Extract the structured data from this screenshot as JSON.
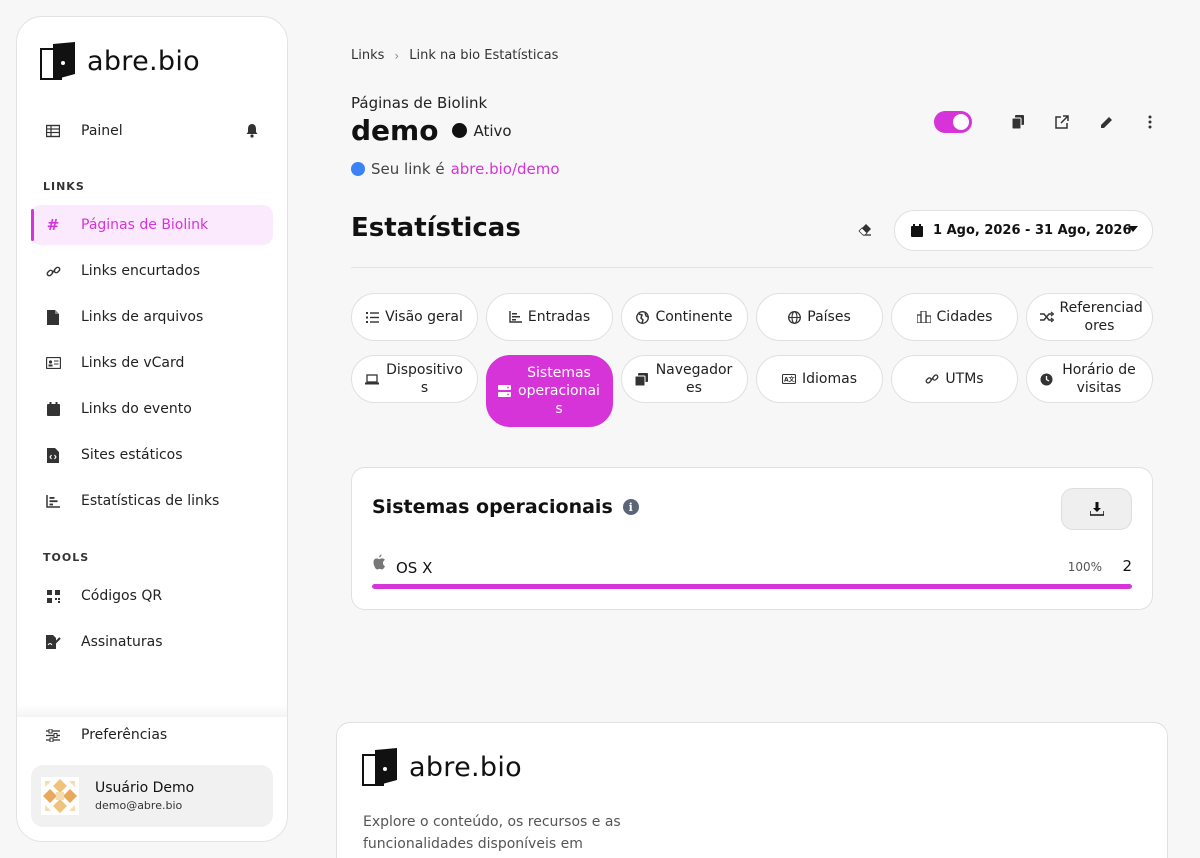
{
  "brand": {
    "name": "abre.bio",
    "accent": "#d633d9"
  },
  "sidebar": {
    "painel": "Painel",
    "section_links": "LINKS",
    "items": [
      {
        "label": "Páginas de Biolink",
        "icon": "hash-icon"
      },
      {
        "label": "Links encurtados",
        "icon": "link-icon"
      },
      {
        "label": "Links de arquivos",
        "icon": "file-icon"
      },
      {
        "label": "Links de vCard",
        "icon": "vcard-icon"
      },
      {
        "label": "Links do evento",
        "icon": "calendar-icon"
      },
      {
        "label": "Sites estáticos",
        "icon": "file-code-icon"
      },
      {
        "label": "Estatísticas de links",
        "icon": "chart-icon"
      }
    ],
    "section_tools": "TOOLS",
    "tools": [
      {
        "label": "Códigos QR",
        "icon": "qr-icon"
      },
      {
        "label": "Assinaturas",
        "icon": "signature-icon"
      }
    ],
    "preferences": "Preferências",
    "user": {
      "name": "Usuário Demo",
      "email": "demo@abre.bio"
    }
  },
  "breadcrumb": {
    "first": "Links",
    "sep": "›",
    "current": "Link na bio Estatísticas"
  },
  "header": {
    "kicker": "Páginas de Biolink",
    "title": "demo",
    "status": "Ativo",
    "link_prefix": "Seu link é",
    "link_url": "abre.bio/demo"
  },
  "stats": {
    "title": "Estatísticas",
    "date_range": "1 Ago, 2026 - 31 Ago, 2026"
  },
  "tabs": [
    {
      "label": "Visão geral",
      "icon": "list-icon"
    },
    {
      "label": "Entradas",
      "icon": "bar-chart-icon"
    },
    {
      "label": "Continente",
      "icon": "globe-americas-icon"
    },
    {
      "label": "Países",
      "icon": "globe-icon"
    },
    {
      "label": "Cidades",
      "icon": "city-icon"
    },
    {
      "label": "Referenciad ores",
      "icon": "random-icon"
    },
    {
      "label": "Dispositivo s",
      "icon": "laptop-icon"
    },
    {
      "label": "Sistemas operacionai s",
      "icon": "server-icon",
      "active": true
    },
    {
      "label": "Navegador es",
      "icon": "window-icon"
    },
    {
      "label": "Idiomas",
      "icon": "language-icon"
    },
    {
      "label": "UTMs",
      "icon": "link-icon"
    },
    {
      "label": "Horário de visitas",
      "icon": "clock-icon"
    }
  ],
  "os_card": {
    "title": "Sistemas operacionais",
    "info": "i",
    "rows": [
      {
        "name": "OS X",
        "icon": "apple-icon",
        "percent": "100%",
        "count": "2",
        "fraction": 1.0
      }
    ]
  },
  "footer": {
    "brand": "abre.bio",
    "text": "Explore o conteúdo, os recursos e as funcionalidades disponíveis em"
  }
}
